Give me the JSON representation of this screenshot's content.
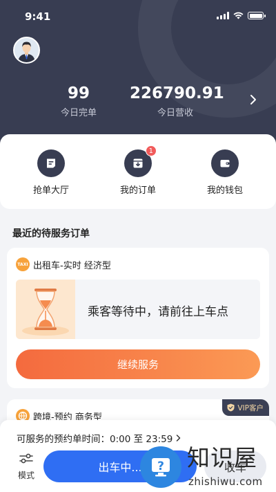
{
  "status_bar": {
    "time": "9:41"
  },
  "header": {
    "stats": [
      {
        "value": "99",
        "label": "今日完单"
      },
      {
        "value": "226790.91",
        "label": "今日营收"
      }
    ]
  },
  "quick_actions": [
    {
      "label": "抢单大厅",
      "icon": "hall-icon"
    },
    {
      "label": "我的订单",
      "icon": "order-icon",
      "badge": "1"
    },
    {
      "label": "我的钱包",
      "icon": "wallet-icon"
    }
  ],
  "section_title": "最近的待服务订单",
  "order_1": {
    "icon_text": "TAXI",
    "type": "出租车-实时 经济型",
    "waiting_message": "乘客等待中，请前往上车点",
    "action_label": "继续服务"
  },
  "order_2": {
    "type": "跨境-预约 商务型",
    "vip_label": "VIP客户"
  },
  "bottom": {
    "schedule_text": "可服务的预约单时间：0:00 至 23:59",
    "mode_label": "模式",
    "go_label": "出车中...",
    "stop_label": "收车"
  },
  "watermark": {
    "title": "知识屋",
    "url": "zhishiwu.com"
  },
  "colors": {
    "header_bg": "#383d52",
    "primary_blue": "#2f6ef3",
    "accent_orange": "#f46a3e",
    "badge_red": "#f15b5b",
    "vip_gold": "#f3d6a5"
  }
}
